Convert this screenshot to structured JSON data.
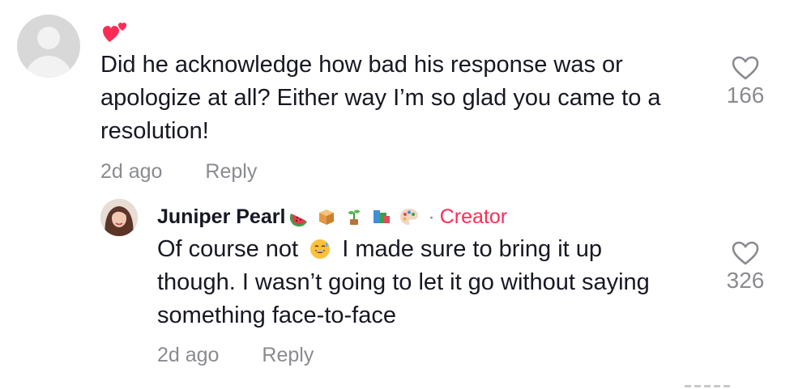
{
  "comment": {
    "text": "Did he acknowledge how bad his response was or apologize at all? Either way I’m so glad you came to a resolution!",
    "time": "2d ago",
    "reply_label": "Reply",
    "likes": "166",
    "reaction_icon": "two-hearts-icon",
    "accent_color": "#fe2c55"
  },
  "reply": {
    "username": "Juniper Pearl",
    "badges": [
      "watermelon-icon",
      "box-icon",
      "seedling-icon",
      "books-icon",
      "palette-icon"
    ],
    "separator": "·",
    "role": "Creator",
    "text_before": "Of course not",
    "inline_emoji": "sweat-smile-icon",
    "text_after": "I made sure to bring it up though. I wasn’t going to let it go without saying something face-to-face",
    "time": "2d ago",
    "reply_label": "Reply",
    "likes": "326"
  }
}
